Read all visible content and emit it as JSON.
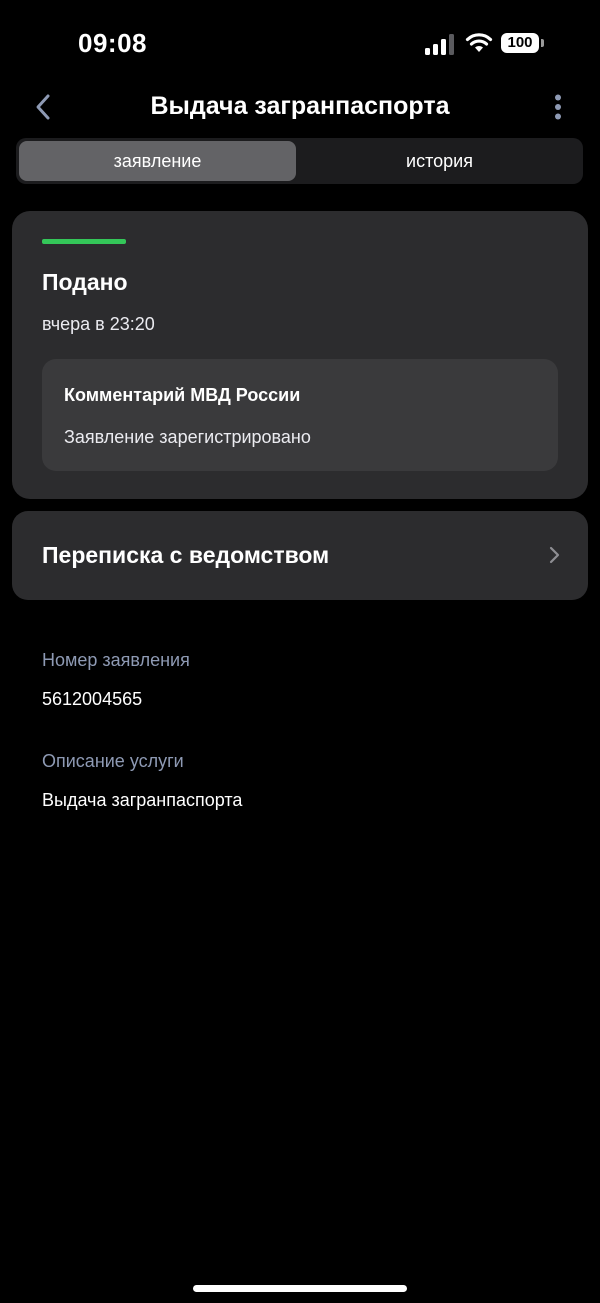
{
  "status_bar": {
    "time": "09:08",
    "battery": "100",
    "signal_icon": "cellular-signal-icon",
    "wifi_icon": "wifi-icon",
    "battery_icon": "battery-icon"
  },
  "header": {
    "title": "Выдача загранпаспорта",
    "back_icon": "chevron-left-icon",
    "menu_icon": "more-vertical-icon"
  },
  "tabs": [
    {
      "label": "заявление",
      "active": true
    },
    {
      "label": "история",
      "active": false
    }
  ],
  "status_card": {
    "status": "Подано",
    "date": "вчера в 23:20",
    "status_color": "#34c759",
    "comment": {
      "title": "Комментарий МВД России",
      "text": "Заявление зарегистрировано"
    }
  },
  "correspondence": {
    "label": "Переписка с ведомством",
    "chevron_icon": "chevron-right-icon"
  },
  "details": [
    {
      "label": "Номер заявления",
      "value": "5612004565"
    },
    {
      "label": "Описание услуги",
      "value": "Выдача загранпаспорта"
    }
  ],
  "colors": {
    "background": "#000000",
    "card": "#2c2c2e",
    "inner_card": "#3a3a3c",
    "accent_green": "#34c759",
    "label_muted": "#8e9ab4"
  }
}
